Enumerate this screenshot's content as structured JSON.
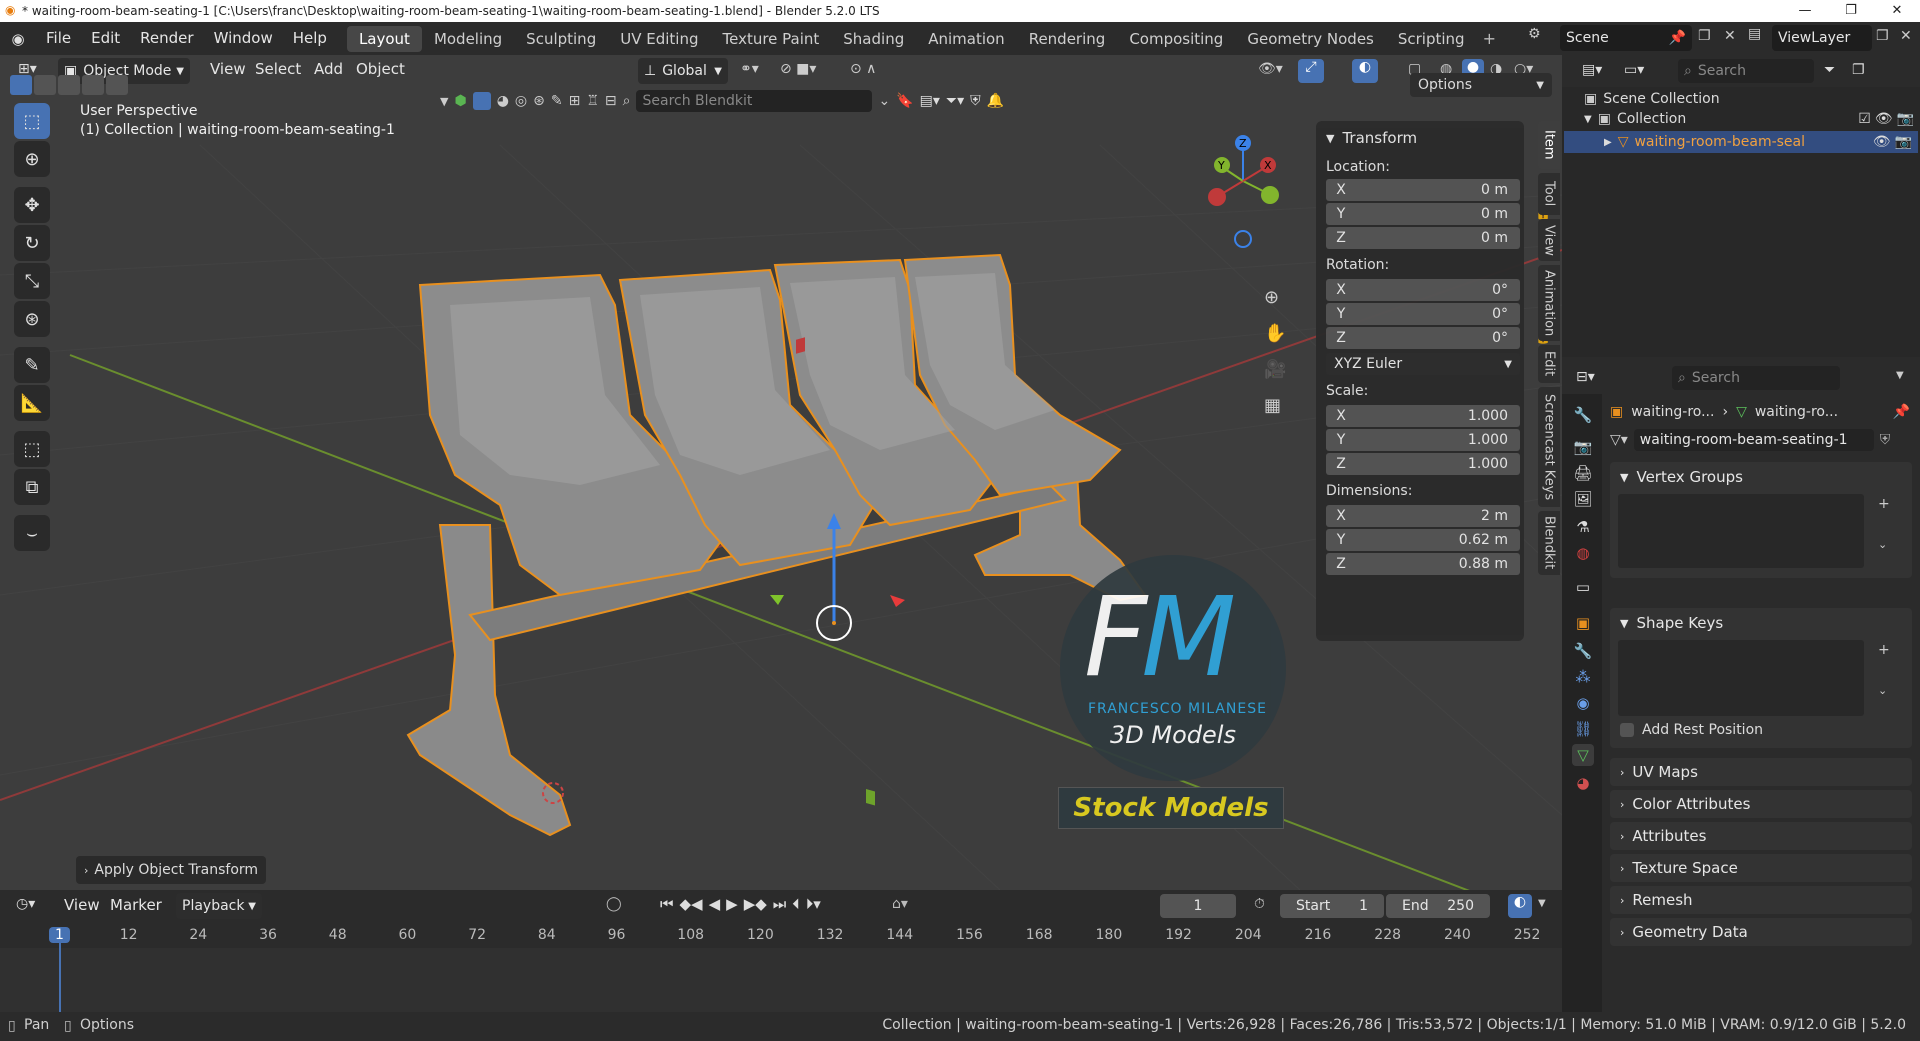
{
  "window": {
    "title": "* waiting-room-beam-seating-1 [C:\\Users\\franc\\Desktop\\waiting-room-beam-seating-1\\waiting-room-beam-seating-1.blend] - Blender 5.2.0 LTS"
  },
  "menu": {
    "items": [
      "File",
      "Edit",
      "Render",
      "Window",
      "Help"
    ]
  },
  "workspaces": {
    "tabs": [
      "Layout",
      "Modeling",
      "Sculpting",
      "UV Editing",
      "Texture Paint",
      "Shading",
      "Animation",
      "Rendering",
      "Compositing",
      "Geometry Nodes",
      "Scripting"
    ],
    "active": "Layout"
  },
  "scene": {
    "name": "Scene",
    "view_layer": "ViewLayer"
  },
  "viewport": {
    "mode": "Object Mode",
    "menu": [
      "View",
      "Select",
      "Add",
      "Object"
    ],
    "orientation": "Global",
    "perspective_label": "User Perspective",
    "collection_label": "(1) Collection | waiting-room-beam-seating-1",
    "search_placeholder": "Search Blendkit",
    "options_label": "Options",
    "operator_panel": "Apply Object Transform",
    "watermark": {
      "initials": "FM",
      "author": "FRANCESCO MILANESE",
      "sub": "3D Models",
      "banner": "Stock Models"
    }
  },
  "n_panel": {
    "tabs": [
      "Item",
      "Tool",
      "View",
      "Animation",
      "Edit",
      "Screencast Keys",
      "Blendkit"
    ],
    "title": "Transform",
    "location_label": "Location:",
    "location": {
      "x": "0 m",
      "y": "0 m",
      "z": "0 m"
    },
    "rotation_label": "Rotation:",
    "rotation": {
      "x": "0°",
      "y": "0°",
      "z": "0°"
    },
    "rotation_mode": "XYZ Euler",
    "scale_label": "Scale:",
    "scale": {
      "x": "1.000",
      "y": "1.000",
      "z": "1.000"
    },
    "dimensions_label": "Dimensions:",
    "dimensions": {
      "x": "2 m",
      "y": "0.62 m",
      "z": "0.88 m"
    },
    "axes": [
      "X",
      "Y",
      "Z"
    ]
  },
  "outliner": {
    "search_placeholder": "Search",
    "scene_collection": "Scene Collection",
    "collection": "Collection",
    "object": "waiting-room-beam-seal"
  },
  "properties": {
    "search_placeholder": "Search",
    "breadcrumb": [
      "waiting-ro...",
      "waiting-ro..."
    ],
    "mesh_name": "waiting-room-beam-seating-1",
    "panels": {
      "vertex_groups": "Vertex Groups",
      "shape_keys": "Shape Keys",
      "add_rest_position": "Add Rest Position",
      "uv_maps": "UV Maps",
      "color_attributes": "Color Attributes",
      "attributes": "Attributes",
      "texture_space": "Texture Space",
      "remesh": "Remesh",
      "geometry_data": "Geometry Data"
    }
  },
  "timeline": {
    "menu": [
      "View",
      "Marker",
      "Playback"
    ],
    "current_frame": "1",
    "start_label": "Start",
    "start": "1",
    "end_label": "End",
    "end": "250",
    "ticks": [
      "1",
      "12",
      "24",
      "36",
      "48",
      "60",
      "72",
      "84",
      "96",
      "108",
      "120",
      "132",
      "144",
      "156",
      "168",
      "180",
      "192",
      "204",
      "216",
      "228",
      "240",
      "252"
    ]
  },
  "status": {
    "left": [
      "Pan",
      "Options"
    ],
    "info": "Collection | waiting-room-beam-seating-1 | Verts:26,928 | Faces:26,786 | Tris:53,572 | Objects:1/1 | Memory: 51.0 MiB | VRAM: 0.9/12.0 GiB | 5.2.0"
  }
}
